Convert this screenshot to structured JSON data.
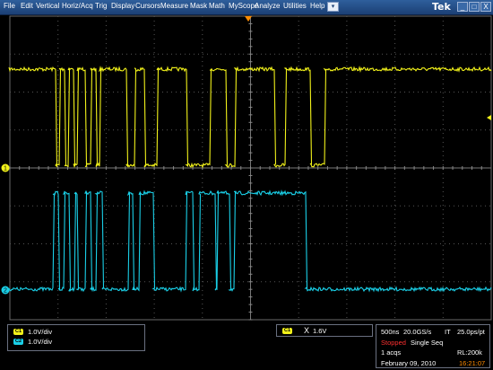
{
  "menu": {
    "items": [
      "File",
      "Edit",
      "Vertical",
      "Horiz/Acq",
      "Trig",
      "Display",
      "Cursors",
      "Measure",
      "Mask",
      "Math",
      "MyScope",
      "Analyze",
      "Utilities",
      "Help"
    ],
    "dropdown_icon": "chevron-down-icon",
    "brand": "Tek"
  },
  "window_controls": {
    "minimize": "_",
    "maximize": "□",
    "close": "X"
  },
  "colors": {
    "ch1": "#f2f21a",
    "ch2": "#1ad0e8",
    "grid": "#5a5a5a",
    "accent": "#ff8c00",
    "stopped": "#ff3030"
  },
  "channels": [
    {
      "id": "C1",
      "scale": "1.0V/div"
    },
    {
      "id": "C2",
      "scale": "1.0V/div"
    }
  ],
  "trigger": {
    "channel": "C1",
    "symbol": "X",
    "level": "1.6V"
  },
  "acquisition": {
    "horizontal_scale": "500ns",
    "sample_rate": "20.0GS/s",
    "mode": "IT",
    "resolution": "25.0ps/pt",
    "state": "Stopped",
    "sequence": "Single Seq",
    "acqs": "1 acqs",
    "record_length": "RL:200k",
    "date": "February 09, 2010",
    "time": "16:21:07"
  },
  "waveforms": {
    "ch1_transitions": [
      62,
      66,
      72,
      76,
      82,
      86,
      95,
      101,
      107,
      111,
      141,
      150,
      161,
      175,
      208,
      234,
      252,
      262,
      306,
      318,
      346,
      362
    ],
    "ch1_start": "high",
    "ch2_transitions": [
      59,
      65,
      71,
      77,
      83,
      86,
      95,
      101,
      107,
      114,
      143,
      148,
      155,
      171,
      207,
      215,
      222,
      240,
      242,
      256,
      261,
      341
    ],
    "ch2_start": "low"
  }
}
